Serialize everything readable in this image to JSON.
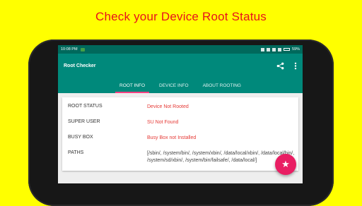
{
  "banner": {
    "headline": "Check your Device Root Status"
  },
  "status_bar": {
    "time": "10:08 PM",
    "battery": "59%"
  },
  "app_bar": {
    "title": "Root Checker",
    "share_icon": "share-icon",
    "menu_icon": "more-vert-icon"
  },
  "tabs": [
    {
      "label": "ROOT INFO",
      "active": true
    },
    {
      "label": "DEVICE INFO",
      "active": false
    },
    {
      "label": "ABOUT ROOTING",
      "active": false
    }
  ],
  "root_info": {
    "rows": [
      {
        "label": "ROOT STATUS",
        "value": "Device Not Rooted"
      },
      {
        "label": "SUPER USER",
        "value": "SU Not Found"
      },
      {
        "label": "BUSY BOX",
        "value": "Busy Box not Installed"
      },
      {
        "label": "PATHS",
        "value": "[/sbin/, /system/bin/, /system/xbin/, /data/local/xbin/, /data/local/bin/, /system/sd/xbin/, /system/bin/failsafe/, /data/local/]"
      }
    ]
  },
  "fab": {
    "icon": "star-icon",
    "glyph": "★"
  },
  "colors": {
    "background": "#ffff00",
    "headline": "#e8111c",
    "primary": "#00897b",
    "primary_dark": "#00695c",
    "accent": "#ff4081",
    "fab": "#e91e63",
    "value": "#e53935"
  }
}
